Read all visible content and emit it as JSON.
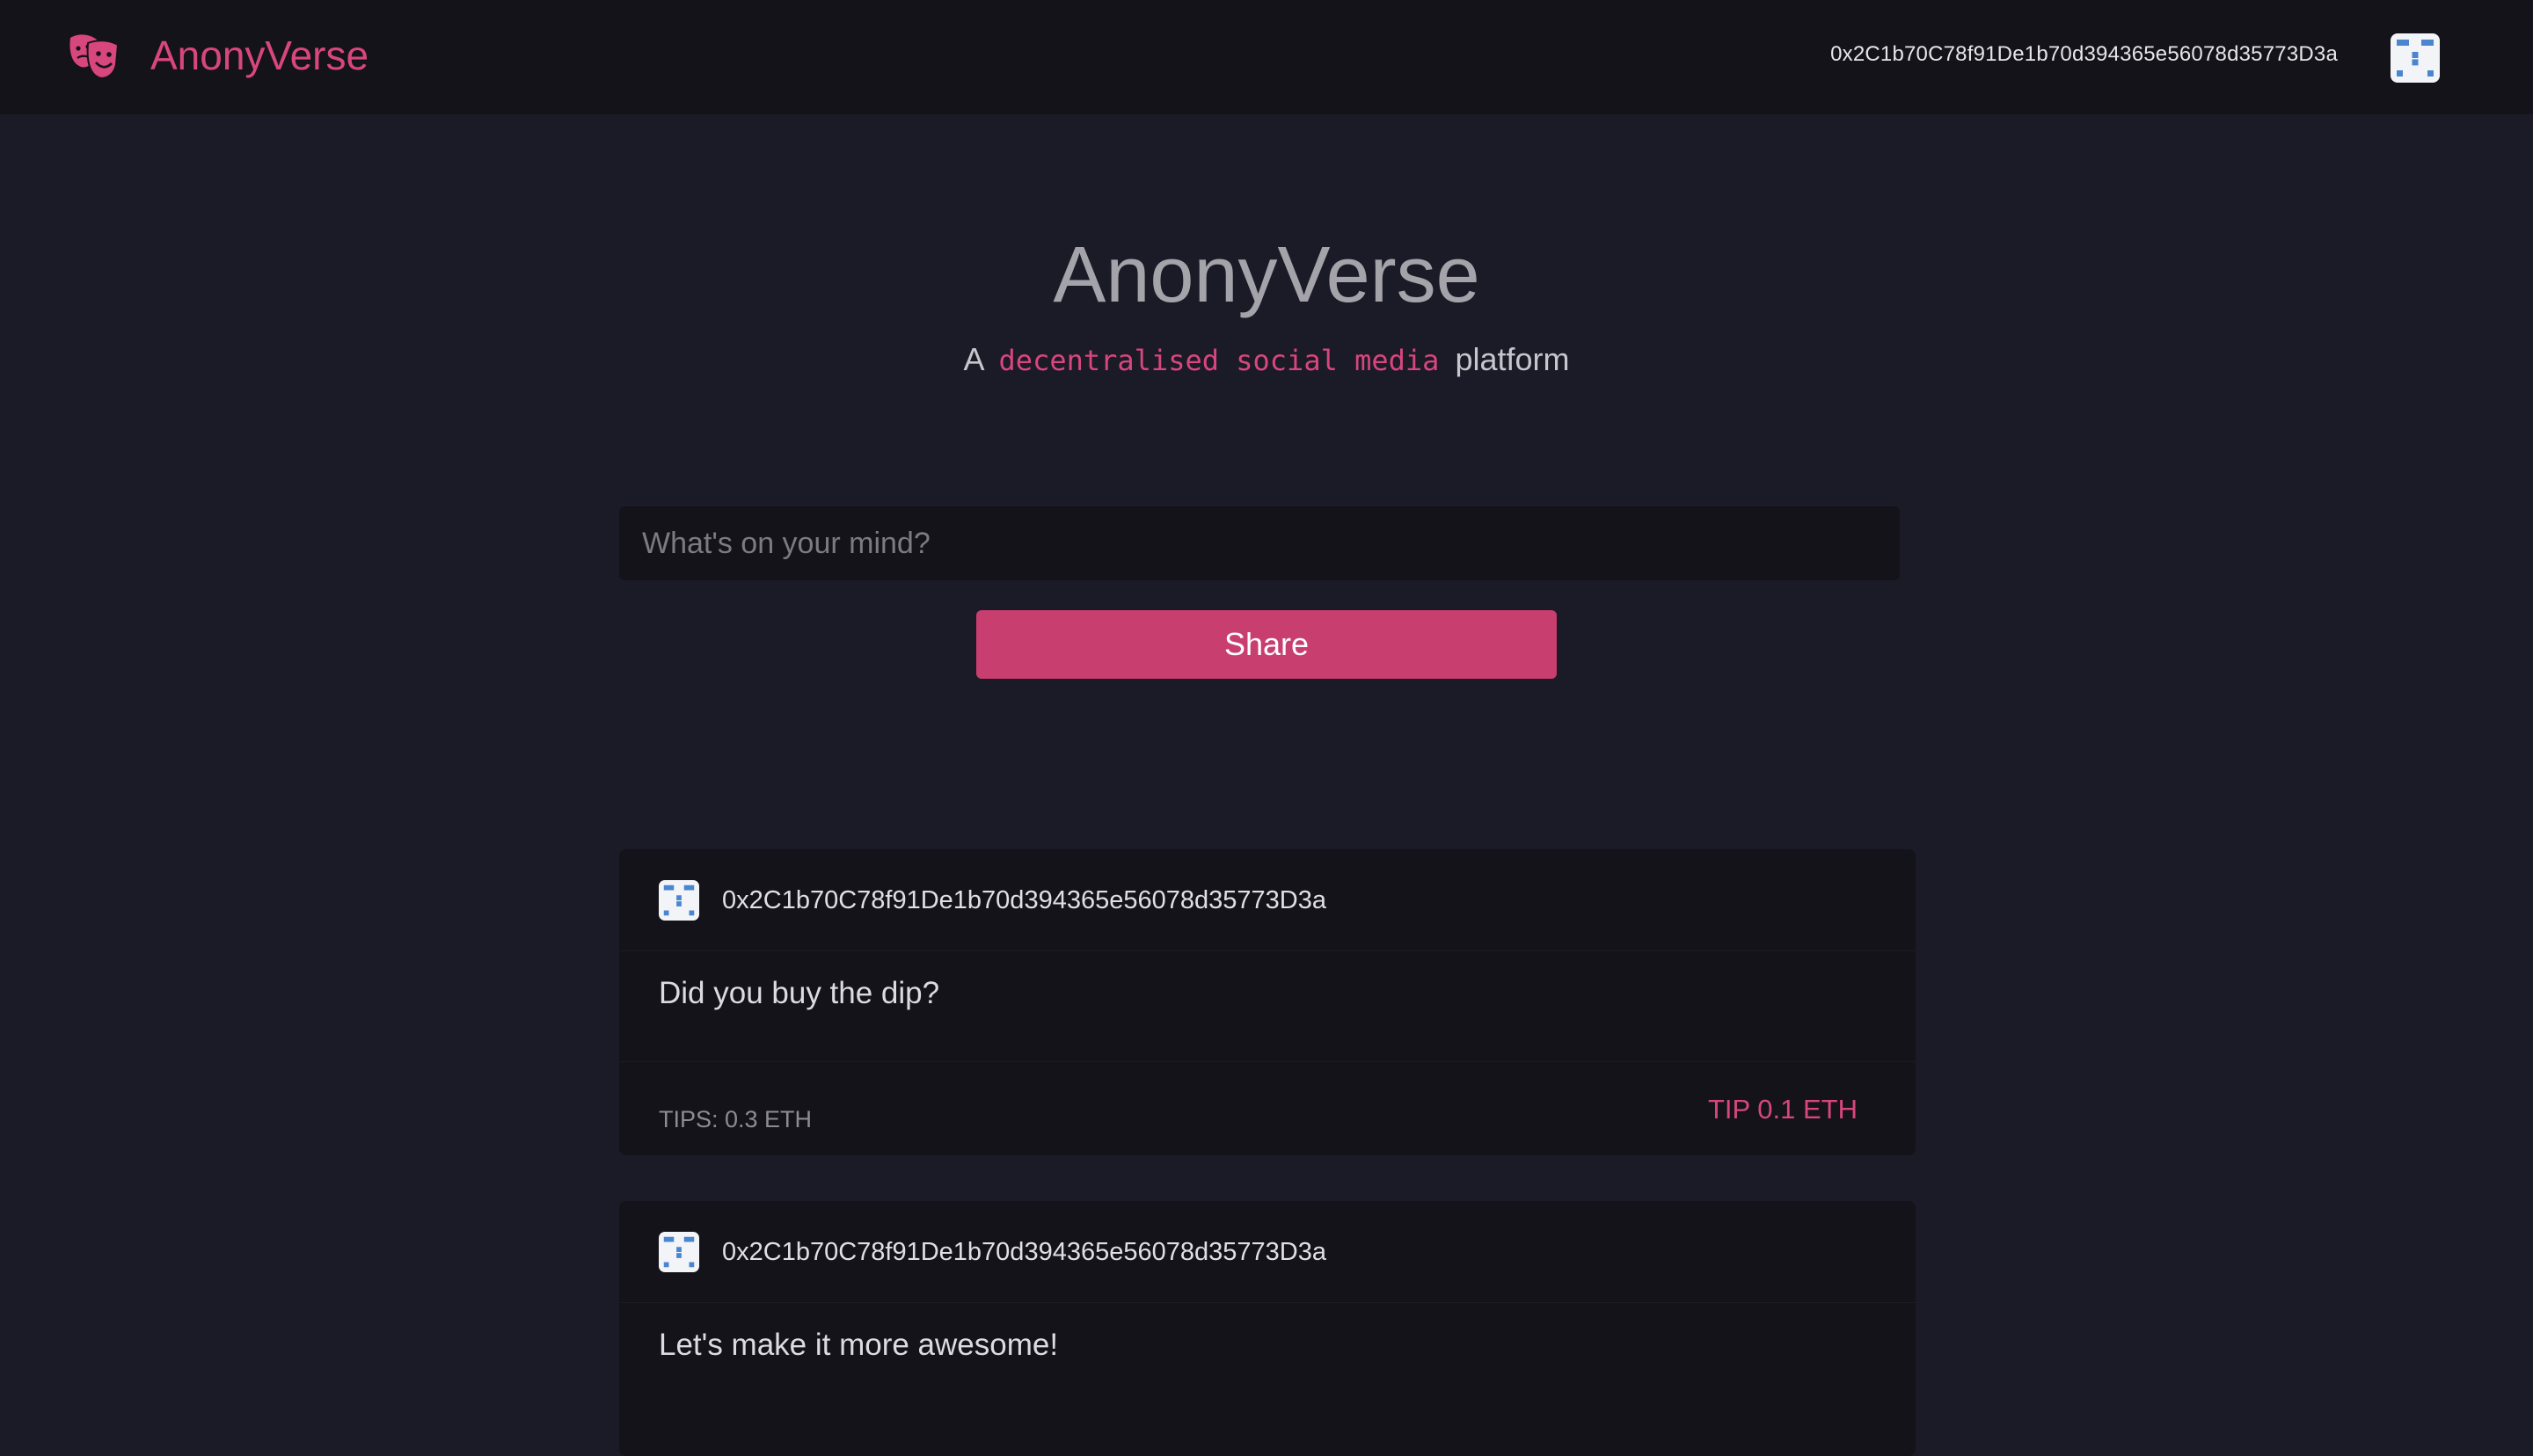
{
  "navbar": {
    "brand_name": "AnonyVerse",
    "brand_icon": "theater-masks-icon",
    "wallet_address": "0x2C1b70C78f91De1b70d394365e56078d35773D3a"
  },
  "hero": {
    "title": "AnonyVerse",
    "subtitle_prefix": "A",
    "subtitle_code": "decentralised social media",
    "subtitle_suffix": "platform"
  },
  "composer": {
    "placeholder": "What's on your mind?",
    "value": "",
    "share_label": "Share"
  },
  "posts": [
    {
      "author": "0x2C1b70C78f91De1b70d394365e56078d35773D3a",
      "text": "Did you buy the dip?",
      "tips": "TIPS: 0.3 ETH",
      "tip_action": "TIP 0.1 ETH"
    },
    {
      "author": "0x2C1b70C78f91De1b70d394365e56078d35773D3a",
      "text": "Let's make it more awesome!"
    }
  ],
  "colors": {
    "accent": "#d8467e",
    "button": "#c83e6f",
    "background": "#1b1a27",
    "surface": "#141319"
  }
}
